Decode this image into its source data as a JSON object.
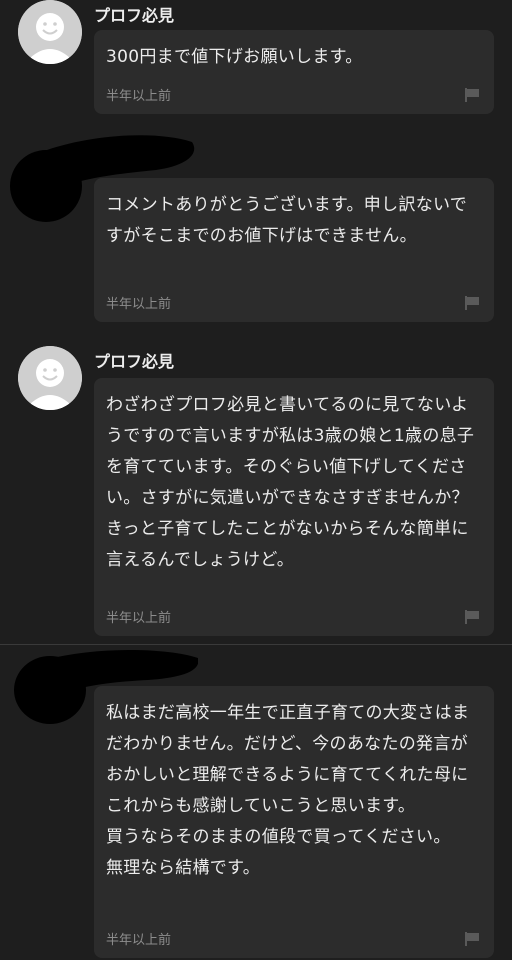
{
  "comments": [
    {
      "user": "プロフ必見",
      "avatar_icon": "default-user-avatar-icon",
      "text": "300円まで値下げお願いします。",
      "time": "半年以上前",
      "report_icon": "flag-icon"
    },
    {
      "user": "",
      "avatar_icon": "redacted-avatar",
      "text": "コメントありがとうございます。申し訳ないですがそこまでのお値下げはできません。",
      "time": "半年以上前",
      "report_icon": "flag-icon"
    },
    {
      "user": "プロフ必見",
      "avatar_icon": "default-user-avatar-icon",
      "text": "わざわざプロフ必見と書いてるのに見てないようですので言いますが私は3歳の娘と1歳の息子を育てています。そのぐらい値下げしてください。さすがに気遣いができなさすぎませんか？きっと子育てしたことがないからそんな簡単に言えるんでしょうけど。",
      "time": "半年以上前",
      "report_icon": "flag-icon"
    },
    {
      "user": "",
      "avatar_icon": "redacted-avatar",
      "text": "私はまだ高校一年生で正直子育ての大変さはまだわかりません。だけど、今のあなたの発言がおかしいと理解できるように育ててくれた母にこれからも感謝していこうと思います。\n買うならそのままの値段で買ってください。\n無理なら結構です。",
      "time": "半年以上前",
      "report_icon": "flag-icon"
    }
  ],
  "colors": {
    "background": "#1e1e1e",
    "bubble": "#2c2c2c",
    "text": "#ececec",
    "muted": "#8d8d8d",
    "redaction": "#000000"
  }
}
